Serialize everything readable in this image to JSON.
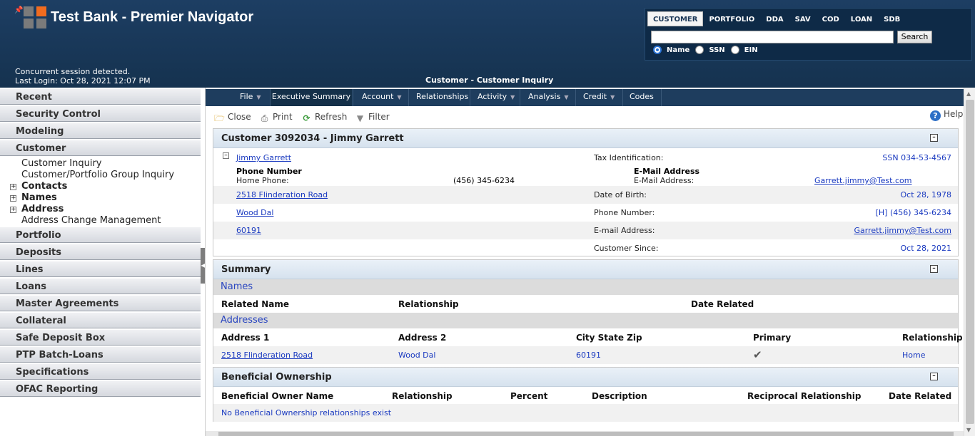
{
  "app": {
    "title": "Test Bank - Premier Navigator"
  },
  "session": {
    "line1": "Concurrent session detected.",
    "line2": "Last Login: Oct 28, 2021 12:07 PM"
  },
  "page_title": "Customer - Customer Inquiry",
  "search": {
    "tabs": [
      "CUSTOMER",
      "PORTFOLIO",
      "DDA",
      "SAV",
      "COD",
      "LOAN",
      "SDB"
    ],
    "active_tab": "CUSTOMER",
    "input_value": "",
    "button_label": "Search",
    "radio_options": [
      "Name",
      "SSN",
      "EIN"
    ],
    "selected_radio": "Name"
  },
  "sidebar": {
    "sections_before": [
      "Recent",
      "Security Control",
      "Modeling",
      "Customer"
    ],
    "customer_items": [
      {
        "label": "Customer Inquiry",
        "type": "item"
      },
      {
        "label": "Customer/Portfolio Group Inquiry",
        "type": "item"
      },
      {
        "label": "Contacts",
        "type": "group"
      },
      {
        "label": "Names",
        "type": "group"
      },
      {
        "label": "Address",
        "type": "group"
      },
      {
        "label": "Address Change Management",
        "type": "item"
      }
    ],
    "sections_after": [
      "Portfolio",
      "Deposits",
      "Lines",
      "Loans",
      "Master Agreements",
      "Collateral",
      "Safe Deposit Box",
      "PTP Batch-Loans",
      "Specifications",
      "OFAC Reporting"
    ]
  },
  "nav": {
    "items": [
      {
        "label": "File",
        "caret": true
      },
      {
        "label": "Executive Summary",
        "caret": false,
        "active": true
      },
      {
        "label": "Account",
        "caret": true
      },
      {
        "label": "Relationships",
        "caret": false
      },
      {
        "label": "Activity",
        "caret": true
      },
      {
        "label": "Analysis",
        "caret": true
      },
      {
        "label": "Credit",
        "caret": true
      },
      {
        "label": "Codes",
        "caret": false
      }
    ]
  },
  "toolbar": {
    "close": "Close",
    "print": "Print",
    "refresh": "Refresh",
    "filter": "Filter",
    "help": "Help"
  },
  "customer": {
    "header": "Customer 3092034 - Jimmy Garrett",
    "name_link": "Jimmy Garrett",
    "phone_heading": "Phone Number",
    "home_phone_label": "Home Phone:",
    "home_phone": "(456) 345-6234",
    "email_heading": "E-Mail Address",
    "email_label": "E-Mail Address:",
    "email": "Garrett.jimmy@Test.com",
    "address1": "2518 Flinderation Road",
    "city": "Wood Dal",
    "zip": "60191",
    "tax_id_label": "Tax Identification:",
    "tax_id": "SSN 034-53-4567",
    "dob_label": "Date of Birth:",
    "dob": "Oct 28, 1978",
    "phone_label": "Phone Number:",
    "phone": "[H] (456) 345-6234",
    "email2_label": "E-mail Address:",
    "email2": "Garrett.jimmy@Test.com",
    "since_label": "Customer Since:",
    "since": "Oct 28, 2021"
  },
  "summary": {
    "header": "Summary",
    "names_title": "Names",
    "names_columns": [
      "Related Name",
      "Relationship",
      "Date Related"
    ],
    "addresses_title": "Addresses",
    "address_columns": [
      "Address 1",
      "Address 2",
      "City State Zip",
      "Primary",
      "Relationship"
    ],
    "address_row": {
      "address1": "2518 Flinderation Road",
      "address2": "Wood Dal",
      "city_state_zip": "60191",
      "primary": true,
      "relationship": "Home"
    }
  },
  "beneficial": {
    "header": "Beneficial Ownership",
    "columns": [
      "Beneficial Owner Name",
      "Relationship",
      "Percent",
      "Description",
      "Reciprocal Relationship",
      "Date Related"
    ],
    "empty_message": "No Beneficial Ownership relationships exist"
  },
  "colors": {
    "header_bg": "#1d3e63",
    "nav_bg": "#1e3d5e",
    "link": "#1a3ac0",
    "logo_accent": "#f26c1f"
  }
}
